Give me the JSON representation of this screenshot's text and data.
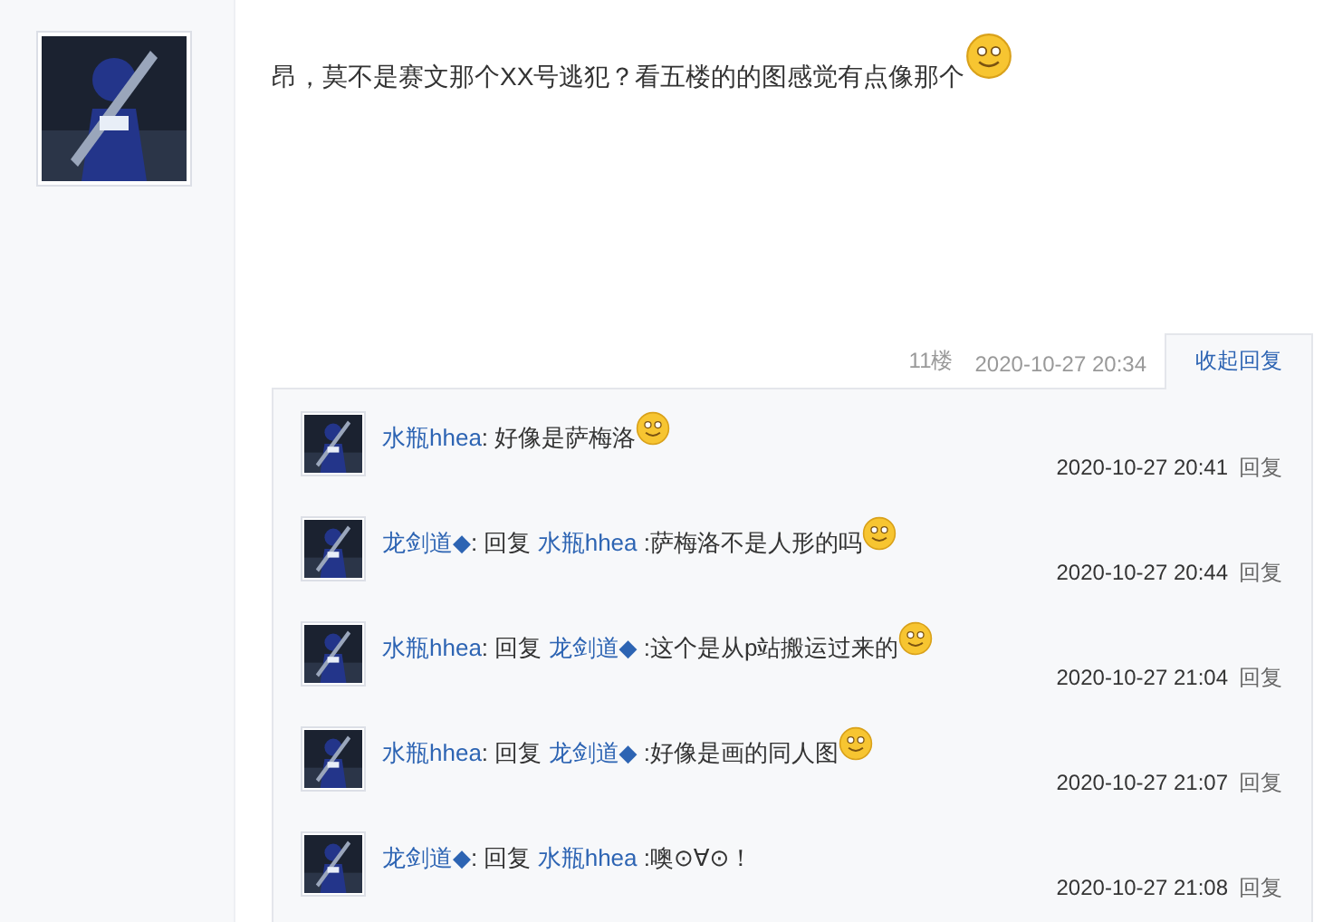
{
  "post": {
    "text": "昂，莫不是赛文那个XX号逃犯？看五楼的的图感觉有点像那个",
    "emoticon": true,
    "floor": "11楼",
    "time": "2020-10-27 20:34",
    "collapse_tab": "收起回复"
  },
  "replies": [
    {
      "segments": [
        {
          "kind": "user",
          "text": "水瓶hhea"
        },
        {
          "kind": "plain",
          "text": ": 好像是萨梅洛"
        }
      ],
      "emoticon": true,
      "time": "2020-10-27 20:41",
      "reply_link": "回复"
    },
    {
      "segments": [
        {
          "kind": "user",
          "text": "龙剑道◆"
        },
        {
          "kind": "plain",
          "text": ": 回复 "
        },
        {
          "kind": "user",
          "text": "水瓶hhea"
        },
        {
          "kind": "plain",
          "text": " :萨梅洛不是人形的吗"
        }
      ],
      "emoticon": true,
      "time": "2020-10-27 20:44",
      "reply_link": "回复"
    },
    {
      "segments": [
        {
          "kind": "user",
          "text": "水瓶hhea"
        },
        {
          "kind": "plain",
          "text": ": 回复 "
        },
        {
          "kind": "user",
          "text": "龙剑道◆"
        },
        {
          "kind": "plain",
          "text": " :这个是从p站搬运过来的"
        }
      ],
      "emoticon": true,
      "time": "2020-10-27 21:04",
      "reply_link": "回复"
    },
    {
      "segments": [
        {
          "kind": "user",
          "text": "水瓶hhea"
        },
        {
          "kind": "plain",
          "text": ": 回复 "
        },
        {
          "kind": "user",
          "text": "龙剑道◆"
        },
        {
          "kind": "plain",
          "text": " :好像是画的同人图"
        }
      ],
      "emoticon": true,
      "time": "2020-10-27 21:07",
      "reply_link": "回复"
    },
    {
      "segments": [
        {
          "kind": "user",
          "text": "龙剑道◆"
        },
        {
          "kind": "plain",
          "text": ": 回复 "
        },
        {
          "kind": "user",
          "text": "水瓶hhea"
        },
        {
          "kind": "plain",
          "text": " :噢⊙∀⊙！"
        }
      ],
      "emoticon": false,
      "time": "2020-10-27 21:08",
      "reply_link": "回复"
    }
  ]
}
